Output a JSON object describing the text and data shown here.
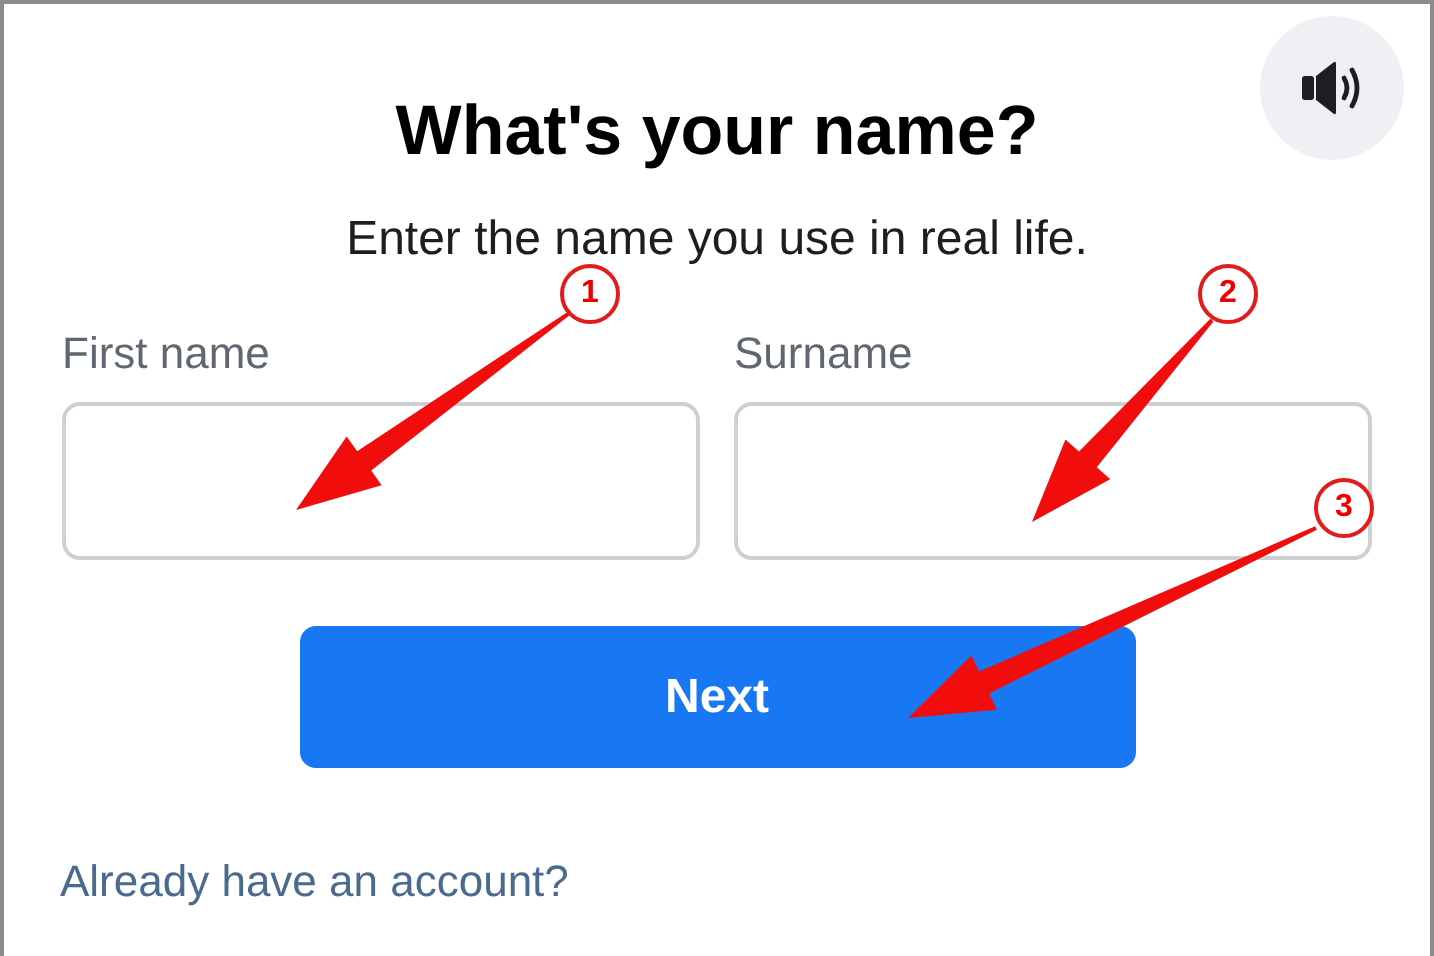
{
  "title": "What's your name?",
  "subtitle": "Enter the name you use in real life.",
  "fields": [
    {
      "label": "First name"
    },
    {
      "label": "Surname"
    }
  ],
  "next_button": "Next",
  "login_link": "Already have an account?",
  "annotations": [
    {
      "number": "1"
    },
    {
      "number": "2"
    },
    {
      "number": "3"
    }
  ]
}
